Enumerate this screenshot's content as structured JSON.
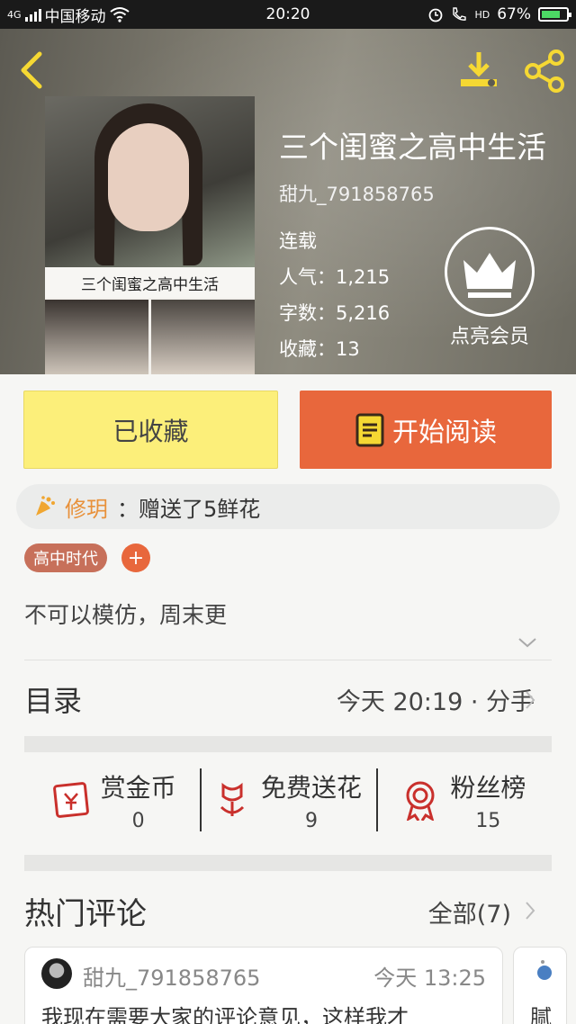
{
  "status_bar": {
    "network": "4G",
    "carrier": "中国移动",
    "time": "20:20",
    "hd": "HD",
    "battery": "67%"
  },
  "book": {
    "cover_caption": "三个闺蜜之高中生活",
    "title": "三个闺蜜之高中生活",
    "author": "甜九_791858765",
    "status": "连载",
    "popularity": "人气：1,215",
    "word_count": "字数：5,216",
    "favorites": "收藏：13"
  },
  "vip": {
    "label": "点亮会员"
  },
  "actions": {
    "collected_label": "已收藏",
    "read_label": "开始阅读"
  },
  "gift": {
    "user": "修玥",
    "message": "：赠送了5鲜花"
  },
  "tags": [
    "高中时代"
  ],
  "tag_add": "+",
  "summary": "不可以模仿，周末更",
  "toc": {
    "title": "目录",
    "latest": "今天 20:19 · 分手"
  },
  "stats": [
    {
      "label": "赏金币",
      "value": "0",
      "icon": "red-envelope-icon"
    },
    {
      "label": "免费送花",
      "value": "9",
      "icon": "flower-icon"
    },
    {
      "label": "粉丝榜",
      "value": "15",
      "icon": "medal-icon"
    }
  ],
  "comments_section": {
    "title": "热门评论",
    "all": "全部(7)"
  },
  "comments": [
    {
      "user": "甜九_791858765",
      "time": "今天 13:25",
      "text": "我现在需要大家的评论意见，这样我才"
    },
    {
      "text": "腻"
    }
  ],
  "colors": {
    "accent": "#e8673c",
    "collected_bg": "#fcef7a",
    "gift_name": "#e8913a",
    "tag_bg": "#c7705a"
  }
}
